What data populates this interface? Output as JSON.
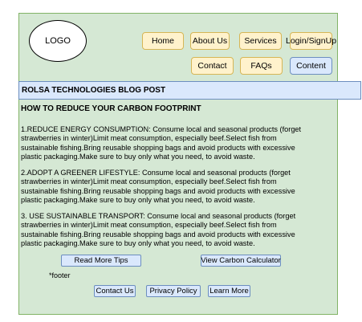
{
  "logo": {
    "label": "LOGO"
  },
  "nav": {
    "home": "Home",
    "about": "About Us",
    "services": "Services",
    "login": "Login/SignUp",
    "contact": "Contact",
    "faqs": "FAQs",
    "content": "Content"
  },
  "header": {
    "title": "ROLSA TECHNOLOGIES  BLOG POST"
  },
  "post": {
    "title": "HOW TO REDUCE YOUR CARBON FOOTPRINT",
    "paragraphs": [
      "1.REDUCE ENERGY CONSUMPTION: Consume local and seasonal products (forget strawberries in winter)Limit meat consumption, especially beef.Select fish from sustainable fishing.Bring reusable shopping bags and avoid products with excessive plastic packaging.Make sure to buy only what you need, to avoid waste.",
      "2.ADOPT A GREENER LIFESTYLE:  Consume local and seasonal products (forget strawberries in winter)Limit meat consumption, especially beef.Select fish from sustainable fishing.Bring reusable shopping bags and avoid products with excessive plastic packaging.Make sure to buy only what you need, to avoid waste.",
      "3. USE SUSTAINABLE TRANSPORT:  Consume local and seasonal products (forget strawberries in winter)Limit meat consumption, especially beef.Select fish from sustainable fishing.Bring reusable shopping bags and avoid products with excessive plastic packaging.Make sure to buy only what you need, to avoid waste."
    ]
  },
  "actions": {
    "read_more": "Read More Tips",
    "carbon_calculator": "View Carbon Calculator"
  },
  "footer": {
    "note": "*footer",
    "contact": "Contact Us",
    "privacy": "Privacy Policy",
    "learn_more": "Learn More"
  },
  "colors": {
    "page_background": "#d5e8d4",
    "nav_button": "#fff2cc",
    "active_button": "#dae8fc",
    "accent_border": "#6c8ebf"
  }
}
